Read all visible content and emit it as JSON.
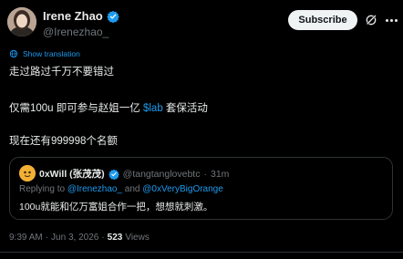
{
  "author": {
    "display_name": "Irene Zhao",
    "handle": "@Irenezhao_"
  },
  "actions": {
    "subscribe_label": "Subscribe"
  },
  "translation": {
    "label": "Show translation"
  },
  "body": {
    "line1": "走过路过千万不要错过",
    "line2_prefix": "仅需100u 即可参与赵姐一亿 ",
    "line2_cashtag": "$lab",
    "line2_suffix": " 套保活动",
    "line3": "现在还有999998个名额"
  },
  "quoted": {
    "display_name": "0xWill (张茂茂)",
    "handle": "@tangtanglovebtc",
    "separator": "·",
    "time": "31m",
    "replying_prefix": "Replying to ",
    "reply_handle_1": "@Irenezhao_",
    "reply_and": " and ",
    "reply_handle_2": "@0xVeryBigOrange",
    "text": "100u就能和亿万富姐合作一把，想想就刺激。"
  },
  "meta": {
    "time": "9:39 AM",
    "separator": "·",
    "date": "Jun 3, 2026",
    "views_count": "523",
    "views_label": "Views"
  },
  "colors": {
    "background": "#000000",
    "accent_blue": "#1d9bf0",
    "text_primary": "#e7e9ea",
    "text_secondary": "#71767b",
    "border": "#2f3336"
  },
  "icons": {
    "verified": "verified-badge-icon",
    "grok": "grok-icon",
    "more": "more-options-icon",
    "translate": "globe-icon"
  }
}
